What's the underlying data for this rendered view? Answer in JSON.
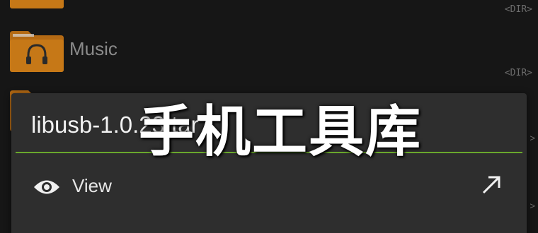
{
  "file_list": {
    "rows": [
      {
        "name": "",
        "tag": "<DIR>",
        "icon": "folder-icon"
      },
      {
        "name": "Music",
        "tag": "<DIR>",
        "icon": "music-folder-icon"
      }
    ]
  },
  "dialog": {
    "title": "libusb-1.0.23.tar",
    "accent_color": "#6aa82c",
    "items": [
      {
        "label": "View",
        "icon": "eye-icon",
        "action_icon": "arrow-up-right-icon"
      }
    ]
  },
  "watermark": {
    "text": "手机工具库"
  }
}
